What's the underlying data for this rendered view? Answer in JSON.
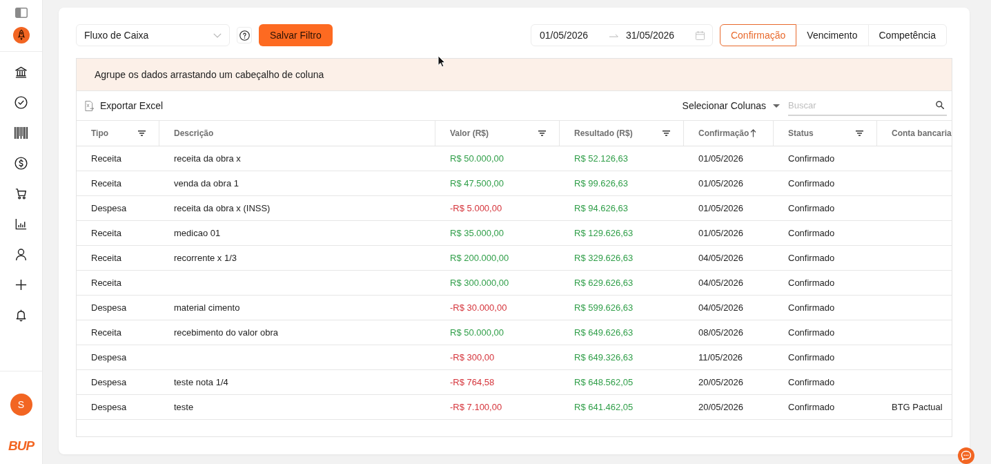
{
  "sidebar": {
    "avatar_initial": "S",
    "logo_text": "BUP"
  },
  "filters": {
    "report_select": {
      "value": "Fluxo de Caixa"
    },
    "save_button": "Salvar Filtro",
    "date_range": {
      "start": "01/05/2026",
      "end": "31/05/2026"
    },
    "date_basis_tabs": [
      {
        "label": "Confirmação",
        "selected": true
      },
      {
        "label": "Vencimento",
        "selected": false
      },
      {
        "label": "Competência",
        "selected": false
      }
    ]
  },
  "grid": {
    "group_panel_hint": "Agrupe os dados arrastando um cabeçalho de coluna",
    "export_button": "Exportar Excel",
    "column_chooser": "Selecionar Colunas",
    "search": {
      "placeholder": "Buscar"
    },
    "columns": [
      {
        "label": "Tipo",
        "filter": true,
        "sorted_ascending": false
      },
      {
        "label": "Descrição",
        "filter": false,
        "sorted_ascending": false
      },
      {
        "label": "Valor (R$)",
        "filter": true,
        "sorted_ascending": false
      },
      {
        "label": "Resultado (R$)",
        "filter": true,
        "sorted_ascending": false
      },
      {
        "label": "Confirmação",
        "filter": false,
        "sorted_ascending": true
      },
      {
        "label": "Status",
        "filter": true,
        "sorted_ascending": false
      },
      {
        "label": "Conta bancaria",
        "filter": false,
        "sorted_ascending": false
      }
    ],
    "rows": [
      {
        "tipo": "Receita",
        "descricao": "receita da obra x",
        "valor": {
          "text": "R$ 50.000,00",
          "negative": false
        },
        "resultado": {
          "text": "R$ 52.126,63",
          "negative": false
        },
        "confirmacao": "01/05/2026",
        "status": "Confirmado"
      },
      {
        "tipo": "Receita",
        "descricao": "venda da obra 1",
        "valor": {
          "text": "R$ 47.500,00",
          "negative": false
        },
        "resultado": {
          "text": "R$ 99.626,63",
          "negative": false
        },
        "confirmacao": "01/05/2026",
        "status": "Confirmado"
      },
      {
        "tipo": "Despesa",
        "descricao": "receita da obra x (INSS)",
        "valor": {
          "text": "-R$ 5.000,00",
          "negative": true
        },
        "resultado": {
          "text": "R$ 94.626,63",
          "negative": false
        },
        "confirmacao": "01/05/2026",
        "status": "Confirmado"
      },
      {
        "tipo": "Receita",
        "descricao": "medicao 01",
        "valor": {
          "text": "R$ 35.000,00",
          "negative": false
        },
        "resultado": {
          "text": "R$ 129.626,63",
          "negative": false
        },
        "confirmacao": "01/05/2026",
        "status": "Confirmado"
      },
      {
        "tipo": "Receita",
        "descricao": "recorrente x 1/3",
        "valor": {
          "text": "R$ 200.000,00",
          "negative": false
        },
        "resultado": {
          "text": "R$ 329.626,63",
          "negative": false
        },
        "confirmacao": "04/05/2026",
        "status": "Confirmado"
      },
      {
        "tipo": "Receita",
        "valor": {
          "text": "R$ 300.000,00",
          "negative": false
        },
        "resultado": {
          "text": "R$ 629.626,63",
          "negative": false
        },
        "confirmacao": "04/05/2026",
        "status": "Confirmado"
      },
      {
        "tipo": "Despesa",
        "descricao": "material cimento",
        "valor": {
          "text": "-R$ 30.000,00",
          "negative": true
        },
        "resultado": {
          "text": "R$ 599.626,63",
          "negative": false
        },
        "confirmacao": "04/05/2026",
        "status": "Confirmado"
      },
      {
        "tipo": "Receita",
        "descricao": "recebimento do valor obra",
        "valor": {
          "text": "R$ 50.000,00",
          "negative": false
        },
        "resultado": {
          "text": "R$ 649.626,63",
          "negative": false
        },
        "confirmacao": "08/05/2026",
        "status": "Confirmado"
      },
      {
        "tipo": "Despesa",
        "valor": {
          "text": "-R$ 300,00",
          "negative": true
        },
        "resultado": {
          "text": "R$ 649.326,63",
          "negative": false
        },
        "confirmacao": "11/05/2026",
        "status": "Confirmado"
      },
      {
        "tipo": "Despesa",
        "descricao": "teste nota 1/4",
        "valor": {
          "text": "-R$ 764,58",
          "negative": true
        },
        "resultado": {
          "text": "R$ 648.562,05",
          "negative": false
        },
        "confirmacao": "20/05/2026",
        "status": "Confirmado"
      },
      {
        "tipo": "Despesa",
        "descricao": "teste",
        "valor": {
          "text": "-R$ 7.100,00",
          "negative": true
        },
        "resultado": {
          "text": "R$ 641.462,05",
          "negative": false
        },
        "confirmacao": "20/05/2026",
        "status": "Confirmado",
        "conta_bancaria": "BTG Pactual"
      }
    ]
  }
}
